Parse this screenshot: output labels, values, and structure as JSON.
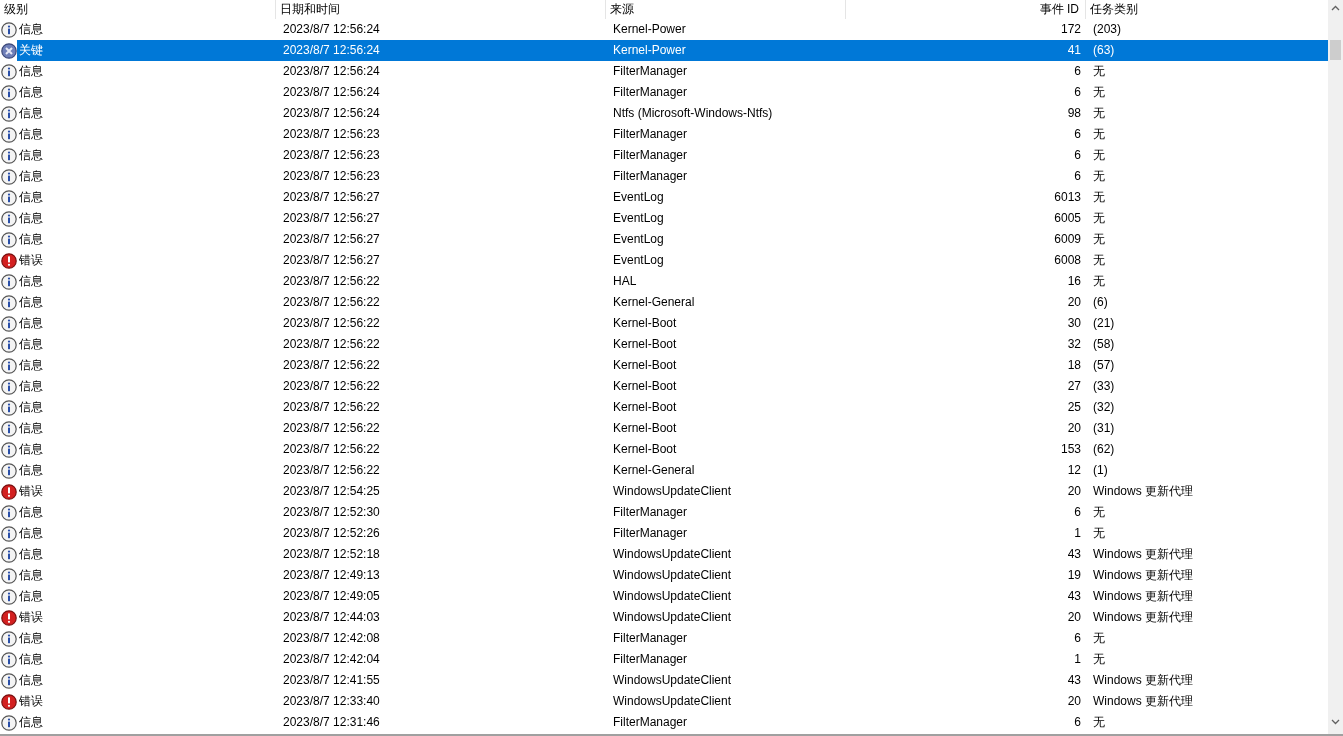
{
  "columns": [
    "级别",
    "日期和时间",
    "来源",
    "事件 ID",
    "任务类别"
  ],
  "rows": [
    {
      "kind": "info",
      "level": "信息",
      "date": "2023/8/7 12:56:24",
      "source": "Kernel-Power",
      "event_id": "172",
      "task": "(203)",
      "selected": false
    },
    {
      "kind": "critical",
      "level": "关键",
      "date": "2023/8/7 12:56:24",
      "source": "Kernel-Power",
      "event_id": "41",
      "task": "(63)",
      "selected": true
    },
    {
      "kind": "info",
      "level": "信息",
      "date": "2023/8/7 12:56:24",
      "source": "FilterManager",
      "event_id": "6",
      "task": "无",
      "selected": false
    },
    {
      "kind": "info",
      "level": "信息",
      "date": "2023/8/7 12:56:24",
      "source": "FilterManager",
      "event_id": "6",
      "task": "无",
      "selected": false
    },
    {
      "kind": "info",
      "level": "信息",
      "date": "2023/8/7 12:56:24",
      "source": "Ntfs (Microsoft-Windows-Ntfs)",
      "event_id": "98",
      "task": "无",
      "selected": false
    },
    {
      "kind": "info",
      "level": "信息",
      "date": "2023/8/7 12:56:23",
      "source": "FilterManager",
      "event_id": "6",
      "task": "无",
      "selected": false
    },
    {
      "kind": "info",
      "level": "信息",
      "date": "2023/8/7 12:56:23",
      "source": "FilterManager",
      "event_id": "6",
      "task": "无",
      "selected": false
    },
    {
      "kind": "info",
      "level": "信息",
      "date": "2023/8/7 12:56:23",
      "source": "FilterManager",
      "event_id": "6",
      "task": "无",
      "selected": false
    },
    {
      "kind": "info",
      "level": "信息",
      "date": "2023/8/7 12:56:27",
      "source": "EventLog",
      "event_id": "6013",
      "task": "无",
      "selected": false
    },
    {
      "kind": "info",
      "level": "信息",
      "date": "2023/8/7 12:56:27",
      "source": "EventLog",
      "event_id": "6005",
      "task": "无",
      "selected": false
    },
    {
      "kind": "info",
      "level": "信息",
      "date": "2023/8/7 12:56:27",
      "source": "EventLog",
      "event_id": "6009",
      "task": "无",
      "selected": false
    },
    {
      "kind": "error",
      "level": "错误",
      "date": "2023/8/7 12:56:27",
      "source": "EventLog",
      "event_id": "6008",
      "task": "无",
      "selected": false
    },
    {
      "kind": "info",
      "level": "信息",
      "date": "2023/8/7 12:56:22",
      "source": "HAL",
      "event_id": "16",
      "task": "无",
      "selected": false
    },
    {
      "kind": "info",
      "level": "信息",
      "date": "2023/8/7 12:56:22",
      "source": "Kernel-General",
      "event_id": "20",
      "task": "(6)",
      "selected": false
    },
    {
      "kind": "info",
      "level": "信息",
      "date": "2023/8/7 12:56:22",
      "source": "Kernel-Boot",
      "event_id": "30",
      "task": "(21)",
      "selected": false
    },
    {
      "kind": "info",
      "level": "信息",
      "date": "2023/8/7 12:56:22",
      "source": "Kernel-Boot",
      "event_id": "32",
      "task": "(58)",
      "selected": false
    },
    {
      "kind": "info",
      "level": "信息",
      "date": "2023/8/7 12:56:22",
      "source": "Kernel-Boot",
      "event_id": "18",
      "task": "(57)",
      "selected": false
    },
    {
      "kind": "info",
      "level": "信息",
      "date": "2023/8/7 12:56:22",
      "source": "Kernel-Boot",
      "event_id": "27",
      "task": "(33)",
      "selected": false
    },
    {
      "kind": "info",
      "level": "信息",
      "date": "2023/8/7 12:56:22",
      "source": "Kernel-Boot",
      "event_id": "25",
      "task": "(32)",
      "selected": false
    },
    {
      "kind": "info",
      "level": "信息",
      "date": "2023/8/7 12:56:22",
      "source": "Kernel-Boot",
      "event_id": "20",
      "task": "(31)",
      "selected": false
    },
    {
      "kind": "info",
      "level": "信息",
      "date": "2023/8/7 12:56:22",
      "source": "Kernel-Boot",
      "event_id": "153",
      "task": "(62)",
      "selected": false
    },
    {
      "kind": "info",
      "level": "信息",
      "date": "2023/8/7 12:56:22",
      "source": "Kernel-General",
      "event_id": "12",
      "task": "(1)",
      "selected": false
    },
    {
      "kind": "error",
      "level": "错误",
      "date": "2023/8/7 12:54:25",
      "source": "WindowsUpdateClient",
      "event_id": "20",
      "task": "Windows 更新代理",
      "selected": false
    },
    {
      "kind": "info",
      "level": "信息",
      "date": "2023/8/7 12:52:30",
      "source": "FilterManager",
      "event_id": "6",
      "task": "无",
      "selected": false
    },
    {
      "kind": "info",
      "level": "信息",
      "date": "2023/8/7 12:52:26",
      "source": "FilterManager",
      "event_id": "1",
      "task": "无",
      "selected": false
    },
    {
      "kind": "info",
      "level": "信息",
      "date": "2023/8/7 12:52:18",
      "source": "WindowsUpdateClient",
      "event_id": "43",
      "task": "Windows 更新代理",
      "selected": false
    },
    {
      "kind": "info",
      "level": "信息",
      "date": "2023/8/7 12:49:13",
      "source": "WindowsUpdateClient",
      "event_id": "19",
      "task": "Windows 更新代理",
      "selected": false
    },
    {
      "kind": "info",
      "level": "信息",
      "date": "2023/8/7 12:49:05",
      "source": "WindowsUpdateClient",
      "event_id": "43",
      "task": "Windows 更新代理",
      "selected": false
    },
    {
      "kind": "error",
      "level": "错误",
      "date": "2023/8/7 12:44:03",
      "source": "WindowsUpdateClient",
      "event_id": "20",
      "task": "Windows 更新代理",
      "selected": false
    },
    {
      "kind": "info",
      "level": "信息",
      "date": "2023/8/7 12:42:08",
      "source": "FilterManager",
      "event_id": "6",
      "task": "无",
      "selected": false
    },
    {
      "kind": "info",
      "level": "信息",
      "date": "2023/8/7 12:42:04",
      "source": "FilterManager",
      "event_id": "1",
      "task": "无",
      "selected": false
    },
    {
      "kind": "info",
      "level": "信息",
      "date": "2023/8/7 12:41:55",
      "source": "WindowsUpdateClient",
      "event_id": "43",
      "task": "Windows 更新代理",
      "selected": false
    },
    {
      "kind": "error",
      "level": "错误",
      "date": "2023/8/7 12:33:40",
      "source": "WindowsUpdateClient",
      "event_id": "20",
      "task": "Windows 更新代理",
      "selected": false
    },
    {
      "kind": "info",
      "level": "信息",
      "date": "2023/8/7 12:31:46",
      "source": "FilterManager",
      "event_id": "6",
      "task": "无",
      "selected": false
    }
  ]
}
